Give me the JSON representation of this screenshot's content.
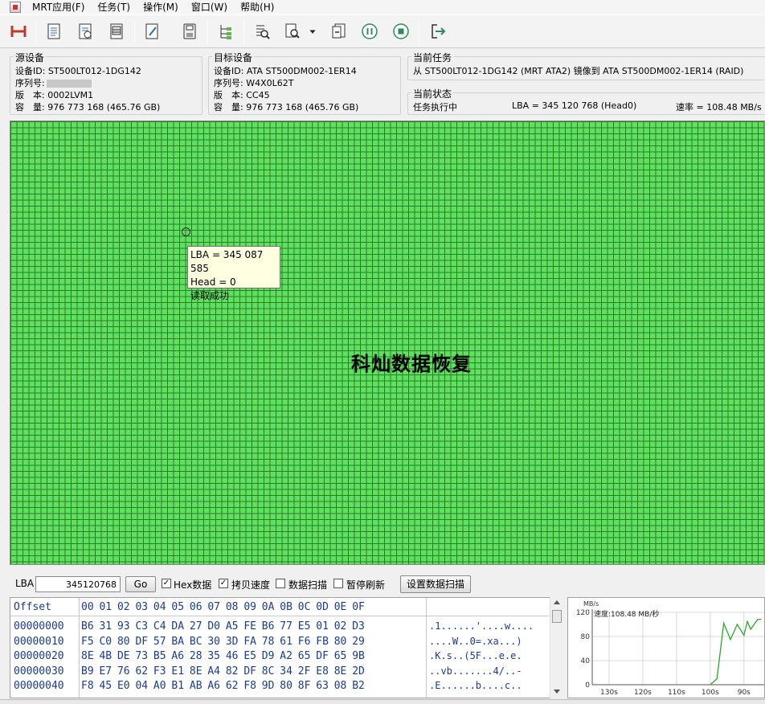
{
  "menu": [
    "MRT应用(F)",
    "任务(T)",
    "操作(M)",
    "窗口(W)",
    "帮助(H)"
  ],
  "source": {
    "title": "源设备",
    "device_id_label": "设备ID:",
    "device_id": "ST500LT012-1DG142",
    "serial_label": "序列号:",
    "version_label": "版　本:",
    "version": "0002LVM1",
    "capacity_label": "容　量:",
    "capacity": "976 773 168 (465.76 GB)"
  },
  "target": {
    "title": "目标设备",
    "device_id_label": "设备ID:",
    "device_id": "ATA ST500DM002-1ER14",
    "serial_label": "序列号:",
    "serial": "W4X0L62T",
    "version_label": "版　本:",
    "version": "CC45",
    "capacity_label": "容　量:",
    "capacity": "976 773 168 (465.76 GB)"
  },
  "task": {
    "title": "当前任务",
    "text": "从 ST500LT012-1DG142 (MRT ATA2) 镜像到 ATA ST500DM002-1ER14 (RAID)"
  },
  "status": {
    "title": "当前状态",
    "state": "任务执行中",
    "lba": "LBA = 345 120 768 (Head0)",
    "speed": "速率 = 108.48 MB/s"
  },
  "tooltip": {
    "lba": "LBA = 345 087 585",
    "head": "Head = 0",
    "result": "读取成功"
  },
  "watermark": "科灿数据恢复",
  "controls": {
    "lba_label": "LBA",
    "lba_value": "345120768",
    "go_label": "Go",
    "hex_label": "Hex数据",
    "hex_checked": true,
    "copy_speed_label": "拷贝速度",
    "copy_speed_checked": true,
    "scan_label": "数据扫描",
    "scan_checked": false,
    "pause_label": "暂停刷新",
    "pause_checked": false,
    "scan_settings_label": "设置数据扫描"
  },
  "hex": {
    "header_offset": "Offset",
    "header_cols": "00 01 02 03 04 05 06 07 08 09 0A 0B 0C 0D 0E 0F",
    "rows": [
      {
        "offset": "00000000",
        "bytes": "B6 31 93 C3 C4 DA 27 D0 A5 FE B6 77 E5 01 02 D3",
        "ascii": ".1......'....w...."
      },
      {
        "offset": "00000010",
        "bytes": "F5 C0 80 DF 57 BA BC 30 3D FA 78 61 F6 FB 80 29",
        "ascii": "....W..0=.xa...)"
      },
      {
        "offset": "00000020",
        "bytes": "8E 4B DE 73 B5 A6 28 35 46 E5 D9 A2 65 DF 65 9B",
        "ascii": ".K.s..(5F...e.e."
      },
      {
        "offset": "00000030",
        "bytes": "B9 E7 76 62 F3 E1 8E A4 82 DF 8C 34 2F E8 8E 2D",
        "ascii": "..vb.......4/..-"
      },
      {
        "offset": "00000040",
        "bytes": "F8 45 E0 04 A0 B1 AB A6 62 F8 9D 80 8F 63 08 B2",
        "ascii": ".E......b....c.."
      }
    ]
  },
  "chart_data": {
    "type": "line",
    "ylabel": "MB/s",
    "annotation": "速度:108.48 MB/秒",
    "ylim": [
      0,
      120
    ],
    "yticks": [
      0,
      40,
      80,
      120
    ],
    "xticks": [
      "130s",
      "120s",
      "110s",
      "100s",
      "90s"
    ],
    "series": [
      {
        "x": [
          100,
          98,
          96,
          94,
          92,
          90,
          89,
          88,
          87,
          86,
          85
        ],
        "values": [
          0,
          10,
          102,
          75,
          100,
          82,
          105,
          92,
          100,
          108,
          108.48
        ]
      }
    ],
    "colors": {
      "line": "#2aaa2a",
      "grid": "#d8d8d8"
    }
  }
}
